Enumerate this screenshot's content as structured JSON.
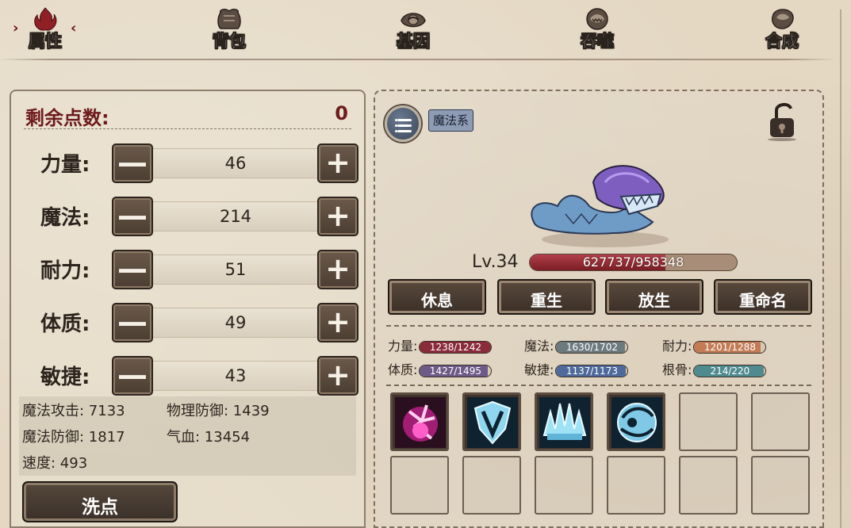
{
  "tabs": {
    "attributes": "属性",
    "bag": "背包",
    "gene": "基因",
    "devour": "吞噬",
    "synthesis": "合成",
    "prev_arrow": "›",
    "next_arrow": "‹"
  },
  "left": {
    "remaining_label": "剩余点数:",
    "remaining_value": "0",
    "stats": [
      {
        "label": "力量:",
        "value": "46"
      },
      {
        "label": "魔法:",
        "value": "214"
      },
      {
        "label": "耐力:",
        "value": "51"
      },
      {
        "label": "体质:",
        "value": "49"
      },
      {
        "label": "敏捷:",
        "value": "43"
      }
    ],
    "minus_glyph": "—",
    "plus_glyph": "+",
    "derived": {
      "magic_attack": "魔法攻击: 7133",
      "physical_defense": "物理防御: 1439",
      "magic_defense": "魔法防御: 1817",
      "hp": "气血: 13454",
      "speed": "速度: 493"
    },
    "reset_label": "洗点"
  },
  "right": {
    "school_tag": "魔法系",
    "level": "Lv.34",
    "hp_text": "627737/958348",
    "hp_fraction": 0.655,
    "actions": {
      "rest": "休息",
      "rebirth": "重生",
      "release": "放生",
      "rename": "重命名"
    },
    "aptitudes": [
      {
        "label": "力量:",
        "value": "1238/1242",
        "fraction": 0.997,
        "color": "#8a2b3b"
      },
      {
        "label": "魔法:",
        "value": "1630/1702",
        "fraction": 0.958,
        "color": "#6c7a7e"
      },
      {
        "label": "耐力:",
        "value": "1201/1288",
        "fraction": 0.932,
        "color": "#c27b55"
      },
      {
        "label": "体质:",
        "value": "1427/1495",
        "fraction": 0.955,
        "color": "#6e5a86"
      },
      {
        "label": "敏捷:",
        "value": "1137/1173",
        "fraction": 0.969,
        "color": "#4f6a9a"
      },
      {
        "label": "根骨:",
        "value": "214/220",
        "fraction": 0.973,
        "color": "#4f8a8e"
      }
    ]
  },
  "colors": {
    "accent_red": "#6d1b1b",
    "button_brown": "#4b3d32",
    "hp_red": "#9a2d36"
  }
}
